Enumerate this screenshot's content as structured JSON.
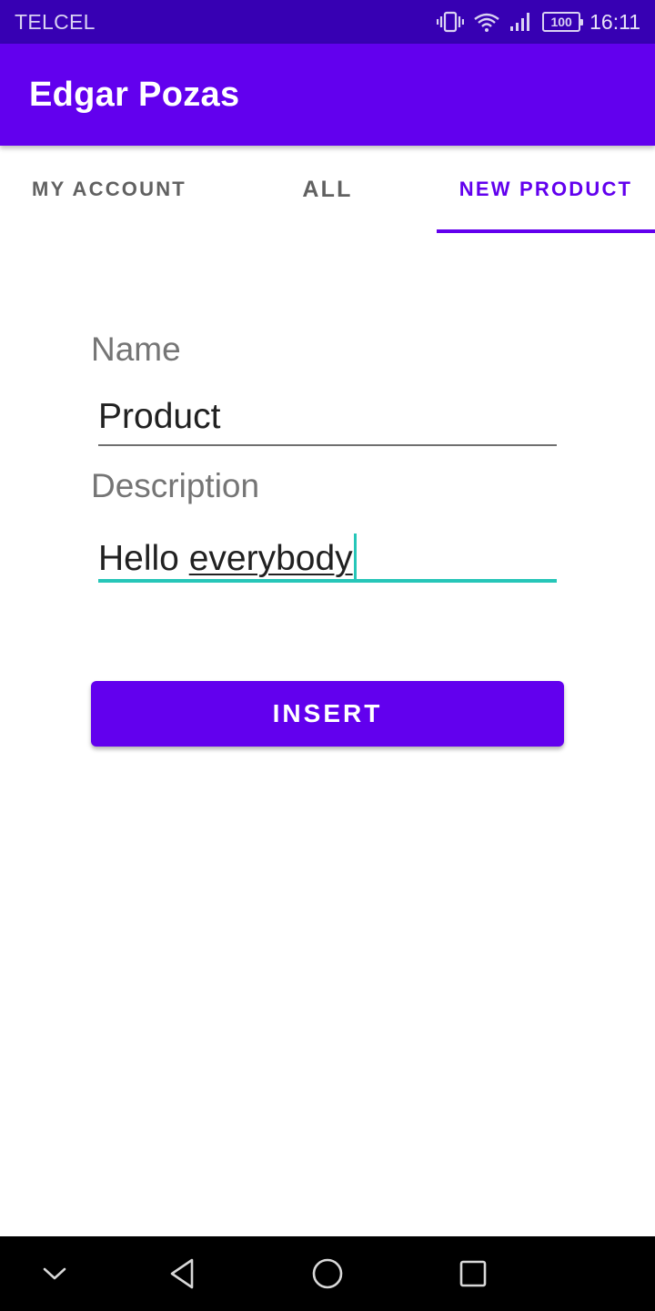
{
  "status_bar": {
    "carrier": "TELCEL",
    "battery": "100",
    "time": "16:11",
    "icons": [
      "vibrate-icon",
      "wifi-icon",
      "signal-icon",
      "battery-icon"
    ]
  },
  "app_bar": {
    "title": "Edgar Pozas"
  },
  "tabs": [
    {
      "label": "MY ACCOUNT",
      "selected": false
    },
    {
      "label": "ALL",
      "selected": false
    },
    {
      "label": "NEW PRODUCT",
      "selected": true
    }
  ],
  "form": {
    "name_label": "Name",
    "name_value": "Product",
    "description_label": "Description",
    "description_value_prefix": "Hello ",
    "description_value_composing": "everybody",
    "insert_label": "INSERT"
  },
  "nav_bar": {
    "icons": [
      "chevron-down-icon",
      "back-icon",
      "home-icon",
      "recents-icon"
    ]
  },
  "colors": {
    "primary": "#6200ee",
    "primary_dark": "#3700b3",
    "accent": "#26c6b8"
  }
}
